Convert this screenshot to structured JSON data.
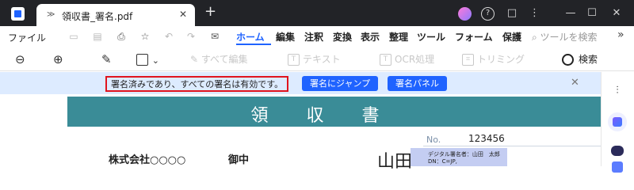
{
  "titlebar": {
    "tab_title": "領収書_署名.pdf",
    "tab_close": "✕",
    "new_tab": "+",
    "help": "?",
    "message_icon": "□",
    "more": "⋮",
    "minimize": "—",
    "maximize": "☐",
    "close": "✕"
  },
  "menubar": {
    "file": "ファイル",
    "items": [
      "ホーム",
      "編集",
      "注釈",
      "変換",
      "表示",
      "整理",
      "ツール",
      "フォーム",
      "保護"
    ],
    "search_placeholder": "ツールを検索",
    "more": "»"
  },
  "toolbar": {
    "zoom_out": "⊖",
    "zoom_in": "⊕",
    "highlight": "✎",
    "shape_caret": "⌄",
    "edit_all": "すべて編集",
    "text": "テキスト",
    "ocr": "OCR処理",
    "crop": "トリミング",
    "search": "検索"
  },
  "banner": {
    "message": "署名済みであり、すべての署名は有効です。",
    "jump_button": "署名にジャンプ",
    "panel_button": "署名パネル",
    "close": "✕"
  },
  "document": {
    "title": "領収書",
    "number_label": "No.",
    "number_value": "123456",
    "company": "株式会社○○○○",
    "honorific": "御中",
    "name": "山田",
    "signature_line1": "デジタル署名者：山田　太郎",
    "signature_line2": "DN：C=JP,"
  },
  "colors": {
    "accent": "#1f63ff",
    "header_teal": "#3a8c97",
    "banner_bg": "#ddebff",
    "highlight_border": "#e0141e",
    "titlebar_bg": "#222327"
  }
}
